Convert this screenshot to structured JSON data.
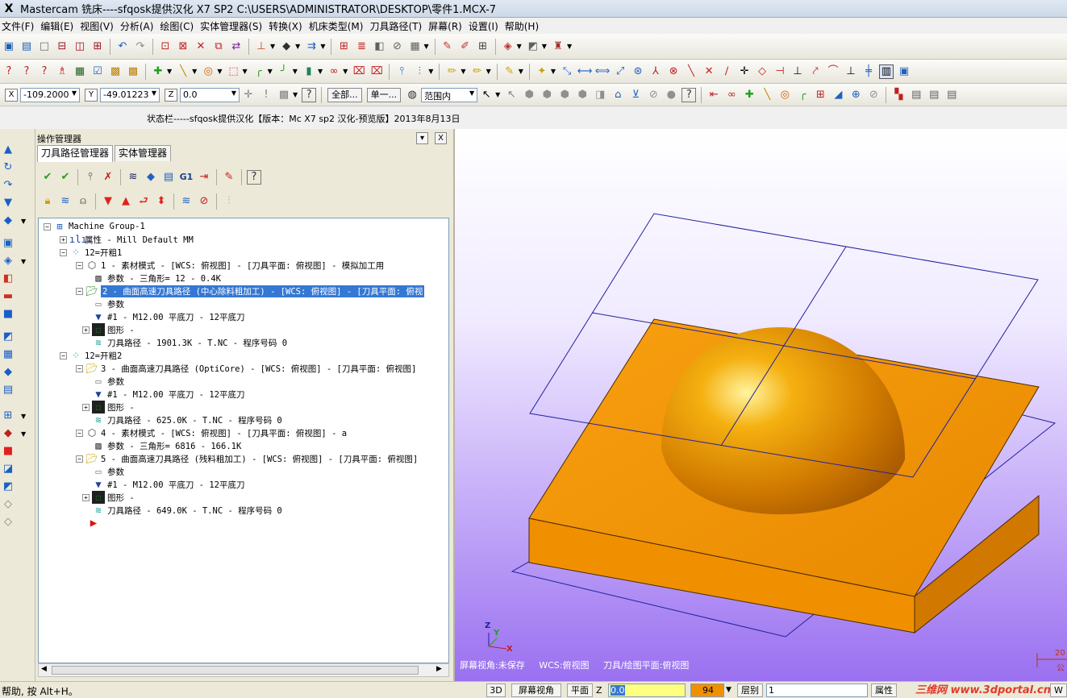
{
  "window": {
    "title": "Mastercam 铣床----sfqosk提供汉化 X7 SP2  C:\\USERS\\ADMINISTRATOR\\DESKTOP\\零件1.MCX-7",
    "app_icon": "X"
  },
  "menu": [
    "文件(F)",
    "编辑(E)",
    "视图(V)",
    "分析(A)",
    "绘图(C)",
    "实体管理器(S)",
    "转换(X)",
    "机床类型(M)",
    "刀具路径(T)",
    "屏幕(R)",
    "设置(I)",
    "帮助(H)"
  ],
  "coords": {
    "x_label": "X",
    "x_value": "-109.2000",
    "y_label": "Y",
    "y_value": "-49.01223",
    "z_label": "Z",
    "z_value": "0.0",
    "all_label": "全部...",
    "single_label": "单一...",
    "range_label": "范围内"
  },
  "status_line": "状态栏-----sfqosk提供汉化【版本：Mc X7 sp2 汉化-预览版】2013年8月13日",
  "panel": {
    "title": "操作管理器",
    "pin": "▾",
    "close": "X",
    "tabs": [
      "刀具路径管理器",
      "实体管理器"
    ],
    "g1_label": "G1"
  },
  "tree": [
    {
      "label": "Machine Group-1"
    },
    {
      "label": "属性 - Mill Default MM"
    },
    {
      "label": "12=开粗1"
    },
    {
      "label": "1 - 素材模式 - [WCS: 俯视图] - [刀具平面: 俯视图] - 模拟加工用"
    },
    {
      "label": "参数 - 三角形= 12 - 0.4K"
    },
    {
      "label": "2 - 曲面高速刀具路径 (中心除料粗加工) - [WCS: 俯视图] - [刀具平面: 俯视"
    },
    {
      "label": "参数"
    },
    {
      "label": "#1 - M12.00 平底刀 - 12平底刀"
    },
    {
      "label": "图形 -"
    },
    {
      "label": "刀具路径 - 1901.3K - T.NC - 程序号码 0"
    },
    {
      "label": "12=开粗2"
    },
    {
      "label": "3 - 曲面高速刀具路径 (OptiCore) - [WCS: 俯视图] - [刀具平面: 俯视图]"
    },
    {
      "label": "参数"
    },
    {
      "label": "#1 - M12.00 平底刀 - 12平底刀"
    },
    {
      "label": "图形 -"
    },
    {
      "label": "刀具路径 - 625.0K - T.NC - 程序号码 0"
    },
    {
      "label": "4 - 素材模式 - [WCS: 俯视图] - [刀具平面: 俯视图] - a"
    },
    {
      "label": "参数 - 三角形= 6816 - 166.1K"
    },
    {
      "label": "5 - 曲面高速刀具路径 (残料粗加工) - [WCS: 俯视图] - [刀具平面: 俯视图]"
    },
    {
      "label": "参数"
    },
    {
      "label": "#1 - M12.00 平底刀 - 12平底刀"
    },
    {
      "label": "图形 -"
    },
    {
      "label": "刀具路径 - 649.0K - T.NC - 程序号码 0"
    }
  ],
  "viewport": {
    "axis_x": "X",
    "axis_y": "Y",
    "axis_z": "Z",
    "screen_view": "屏幕视角:未保存",
    "wcs": "WCS:俯视图",
    "tool_plane": "刀具/绘图平面:俯视图",
    "scale_label": "20",
    "unit_label": "公",
    "colors": {
      "part": "#f0960a",
      "wireframe": "#2020a0"
    }
  },
  "statusbar": {
    "help": "帮助, 按 Alt+H。",
    "btn_3d": "3D",
    "btn_screen_view": "屏幕视角",
    "btn_plane": "平面",
    "z_label": "Z",
    "z_value": "0.0",
    "color_value": "94",
    "level_label": "层别",
    "level_value": "1",
    "attr_label": "属性",
    "w_label": "W",
    "watermark": "三维网 www.3dportal.cn"
  }
}
